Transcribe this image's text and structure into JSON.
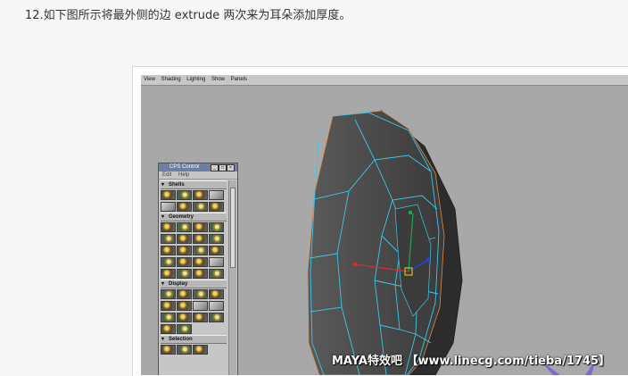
{
  "caption": "12.如下图所示将最外侧的边 extrude 两次来为耳朵添加厚度。",
  "viewport_menu": [
    "View",
    "Shading",
    "Lighting",
    "Show",
    "Panels"
  ],
  "cps_panel": {
    "title": "CPS Control",
    "menu": [
      "Edit",
      "Help"
    ],
    "title_buttons": [
      "_",
      "□",
      "×"
    ],
    "sections": [
      {
        "label": "Shells",
        "rows": 2
      },
      {
        "label": "Geometry",
        "rows": 5
      },
      {
        "label": "Display",
        "rows": 4
      },
      {
        "label": "Selection",
        "rows": 1
      }
    ]
  },
  "watermark": "MAYA特效吧 【www.linecg.com/tieba/1745】",
  "colors": {
    "background": "#f7f7f7",
    "viewport": "#a8a8a8",
    "mesh_face": "#4a4a4a",
    "mesh_edges_selected": "#3fc6e8",
    "mesh_edges_border": "#d98a4a"
  }
}
